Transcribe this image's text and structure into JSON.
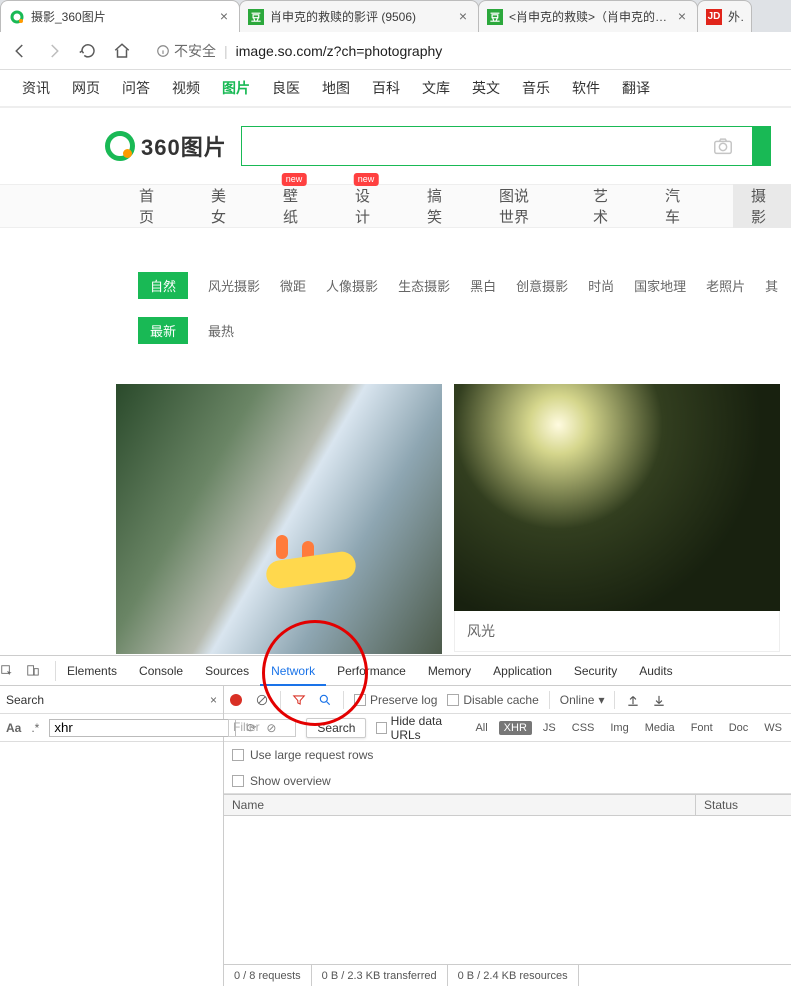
{
  "browser_tabs": [
    {
      "title": "摄影_360图片",
      "favtype": "so"
    },
    {
      "title": "肖申克的救赎的影评 (9506)",
      "favtype": "db"
    },
    {
      "title": "<肖申克的救赎>（肖申克的救赎",
      "favtype": "db"
    },
    {
      "title": "外国小",
      "favtype": "jd"
    }
  ],
  "address_bar": {
    "insecure_label": "不安全",
    "url": "image.so.com/z?ch=photography"
  },
  "site_nav": [
    "资讯",
    "网页",
    "问答",
    "视频",
    "图片",
    "良医",
    "地图",
    "百科",
    "文库",
    "英文",
    "音乐",
    "软件",
    "翻译"
  ],
  "site_nav_active_index": 4,
  "logo_text": "360图片",
  "search_value": "",
  "categories": [
    {
      "label": "首页"
    },
    {
      "label": "美女"
    },
    {
      "label": "壁纸",
      "badge": "new"
    },
    {
      "label": "设计",
      "badge": "new"
    },
    {
      "label": "搞笑"
    },
    {
      "label": "图说世界"
    },
    {
      "label": "艺术"
    },
    {
      "label": "汽车"
    },
    {
      "label": "摄影",
      "trailing": true
    }
  ],
  "filter_row1": {
    "active": "自然",
    "items": [
      "风光摄影",
      "微距",
      "人像摄影",
      "生态摄影",
      "黑白",
      "创意摄影",
      "时尚",
      "国家地理",
      "老照片",
      "其"
    ]
  },
  "filter_row2": {
    "active": "最新",
    "items": [
      "最热"
    ]
  },
  "cards": [
    {
      "caption": ""
    },
    {
      "caption": "风光"
    }
  ],
  "devtools": {
    "top_tabs": [
      "Elements",
      "Console",
      "Sources",
      "Network",
      "Performance",
      "Memory",
      "Application",
      "Security",
      "Audits"
    ],
    "top_active_index": 3,
    "search_panel_title": "Search",
    "search_mode_aa": "Aa",
    "search_mode_re": ".*",
    "search_input_value": "xhr",
    "toolbar": {
      "preserve_log": "Preserve log",
      "disable_cache": "Disable cache",
      "online": "Online"
    },
    "filter_placeholder": "Filter",
    "search_dropdown": "Search",
    "hide_data_urls": "Hide data URLs",
    "type_chips": [
      "All",
      "XHR",
      "JS",
      "CSS",
      "Img",
      "Media",
      "Font",
      "Doc",
      "WS"
    ],
    "type_chip_active_index": 1,
    "use_large_rows": "Use large request rows",
    "show_overview": "Show overview",
    "columns": {
      "name": "Name",
      "status": "Status"
    },
    "footer": [
      "0 / 8 requests",
      "0 B / 2.3 KB transferred",
      "0 B / 2.4 KB resources"
    ]
  }
}
